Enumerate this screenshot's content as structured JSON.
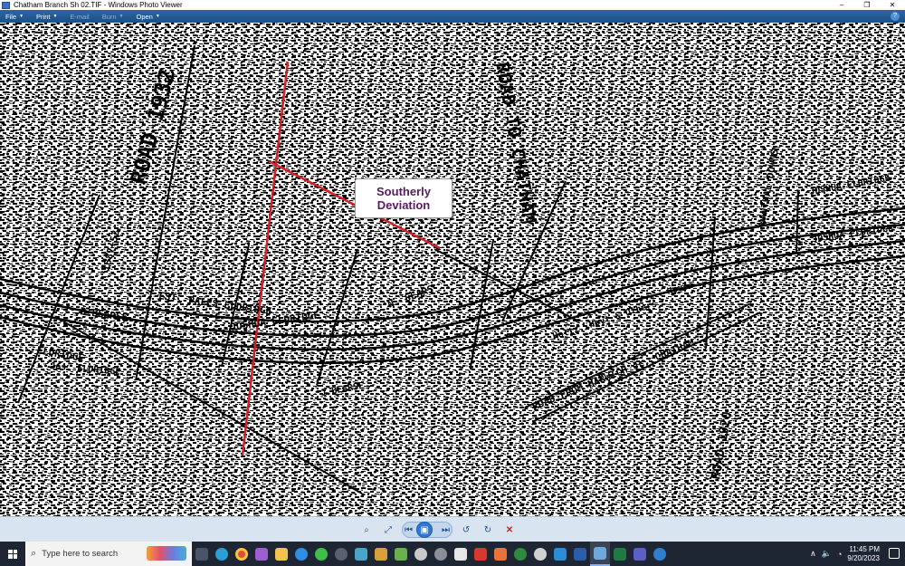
{
  "window": {
    "title": "Chatham Branch Sh 02.TIF - Windows Photo Viewer",
    "minimize": "–",
    "maximize": "❐",
    "close": "✕"
  },
  "menu": {
    "items": [
      {
        "label": "File",
        "enabled": true
      },
      {
        "label": "Print",
        "enabled": true
      },
      {
        "label": "E-mail",
        "enabled": false
      },
      {
        "label": "Burn",
        "enabled": false
      },
      {
        "label": "Open",
        "enabled": true
      }
    ],
    "help": "?"
  },
  "map": {
    "callout_line1": "Southerly",
    "callout_line2": "Deviation",
    "labels": [
      "ROAD 1932",
      "1887+52",
      "B.BEARSE",
      "EST. PALES ELDRIDGE",
      "JOSHUA ELDRIDGE",
      "ELDRIDGE",
      "J.BEARSE",
      "N. SEARS",
      "ROAD TO CHATHAM",
      "Holtz, Hoyt & Others",
      "House",
      "JOSHUA ELDRIDGE",
      "MANTHAL DOWNS",
      "ROAD FROM HARWICH Jc. CHATHAM",
      "ROAD 1920",
      "Jos. ELDRIDGE",
      "S. JOSHUA ELDRIDGE"
    ],
    "colors": {
      "deviation_line": "#d41f26",
      "callout_text": "#5a1a63"
    }
  },
  "navbar": {
    "zoom": "⌕",
    "fit": "⤢",
    "previous": "⏮",
    "slideshow": "▣",
    "next": "⏭",
    "rotate_ccw": "↺",
    "rotate_cw": "↻",
    "delete": "✕"
  },
  "taskbar": {
    "search_placeholder": "Type here to search",
    "time": "11:45 PM",
    "date": "9/20/2023",
    "tray_up": "∧",
    "wifi": "◔",
    "volume": "🔈"
  }
}
